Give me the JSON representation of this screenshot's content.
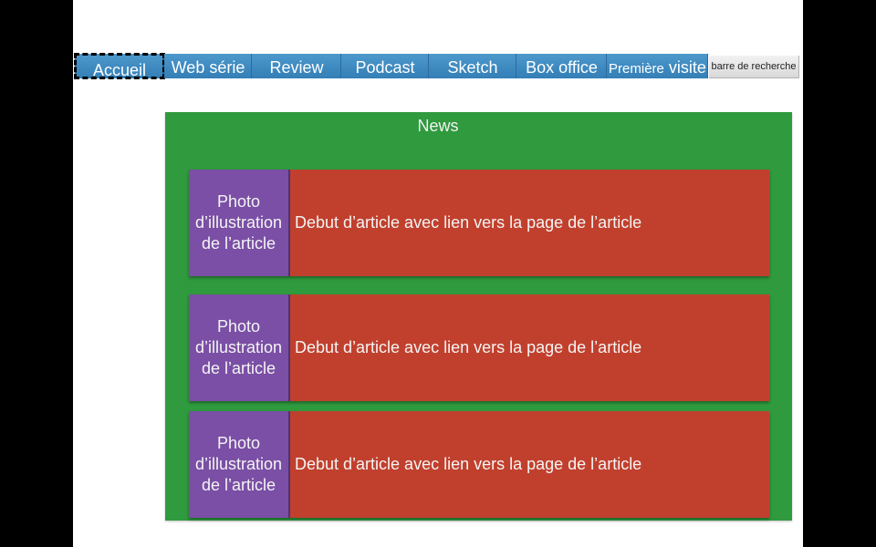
{
  "nav": {
    "items": [
      {
        "label": "Accueil"
      },
      {
        "label": "Web série"
      },
      {
        "label": "Review"
      },
      {
        "label": "Podcast"
      },
      {
        "label": "Sketch"
      },
      {
        "label": "Box office"
      },
      {
        "label_a": "Première",
        "label_b": "visite"
      }
    ],
    "search_label": "barre de recherche"
  },
  "news": {
    "title": "News",
    "articles": [
      {
        "photo_label": "Photo d’illustration de l’article",
        "teaser": "Debut d’article avec lien vers la page de l’article"
      },
      {
        "photo_label": "Photo d’illustration de l’article",
        "teaser": "Debut d’article avec lien vers la page de l’article"
      },
      {
        "photo_label": "Photo d’illustration de l’article",
        "teaser": "Debut d’article avec lien vers la page de l’article"
      }
    ]
  },
  "colors": {
    "nav_blue": "#3f8cc2",
    "news_green": "#2f9a3e",
    "photo_purple": "#7a4fa5",
    "article_red": "#c1402d",
    "search_gray": "#e6e6e6"
  }
}
